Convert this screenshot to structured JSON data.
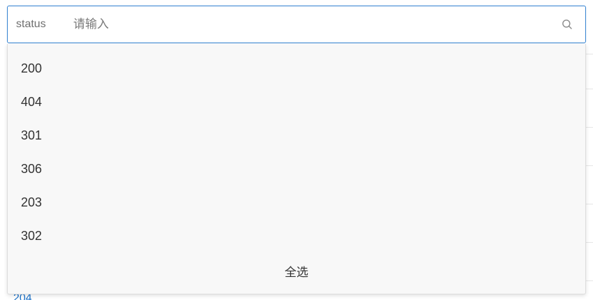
{
  "filter": {
    "label": "status",
    "placeholder": "请输入",
    "value": ""
  },
  "options": [
    "200",
    "404",
    "301",
    "306",
    "203",
    "302"
  ],
  "select_all_label": "全选",
  "background": {
    "partial_link_text": "204"
  },
  "icons": {
    "search": "search-icon"
  },
  "colors": {
    "focus_border": "#2f7fd0",
    "link": "#1b72c9",
    "dropdown_bg": "#f8f8f8"
  }
}
